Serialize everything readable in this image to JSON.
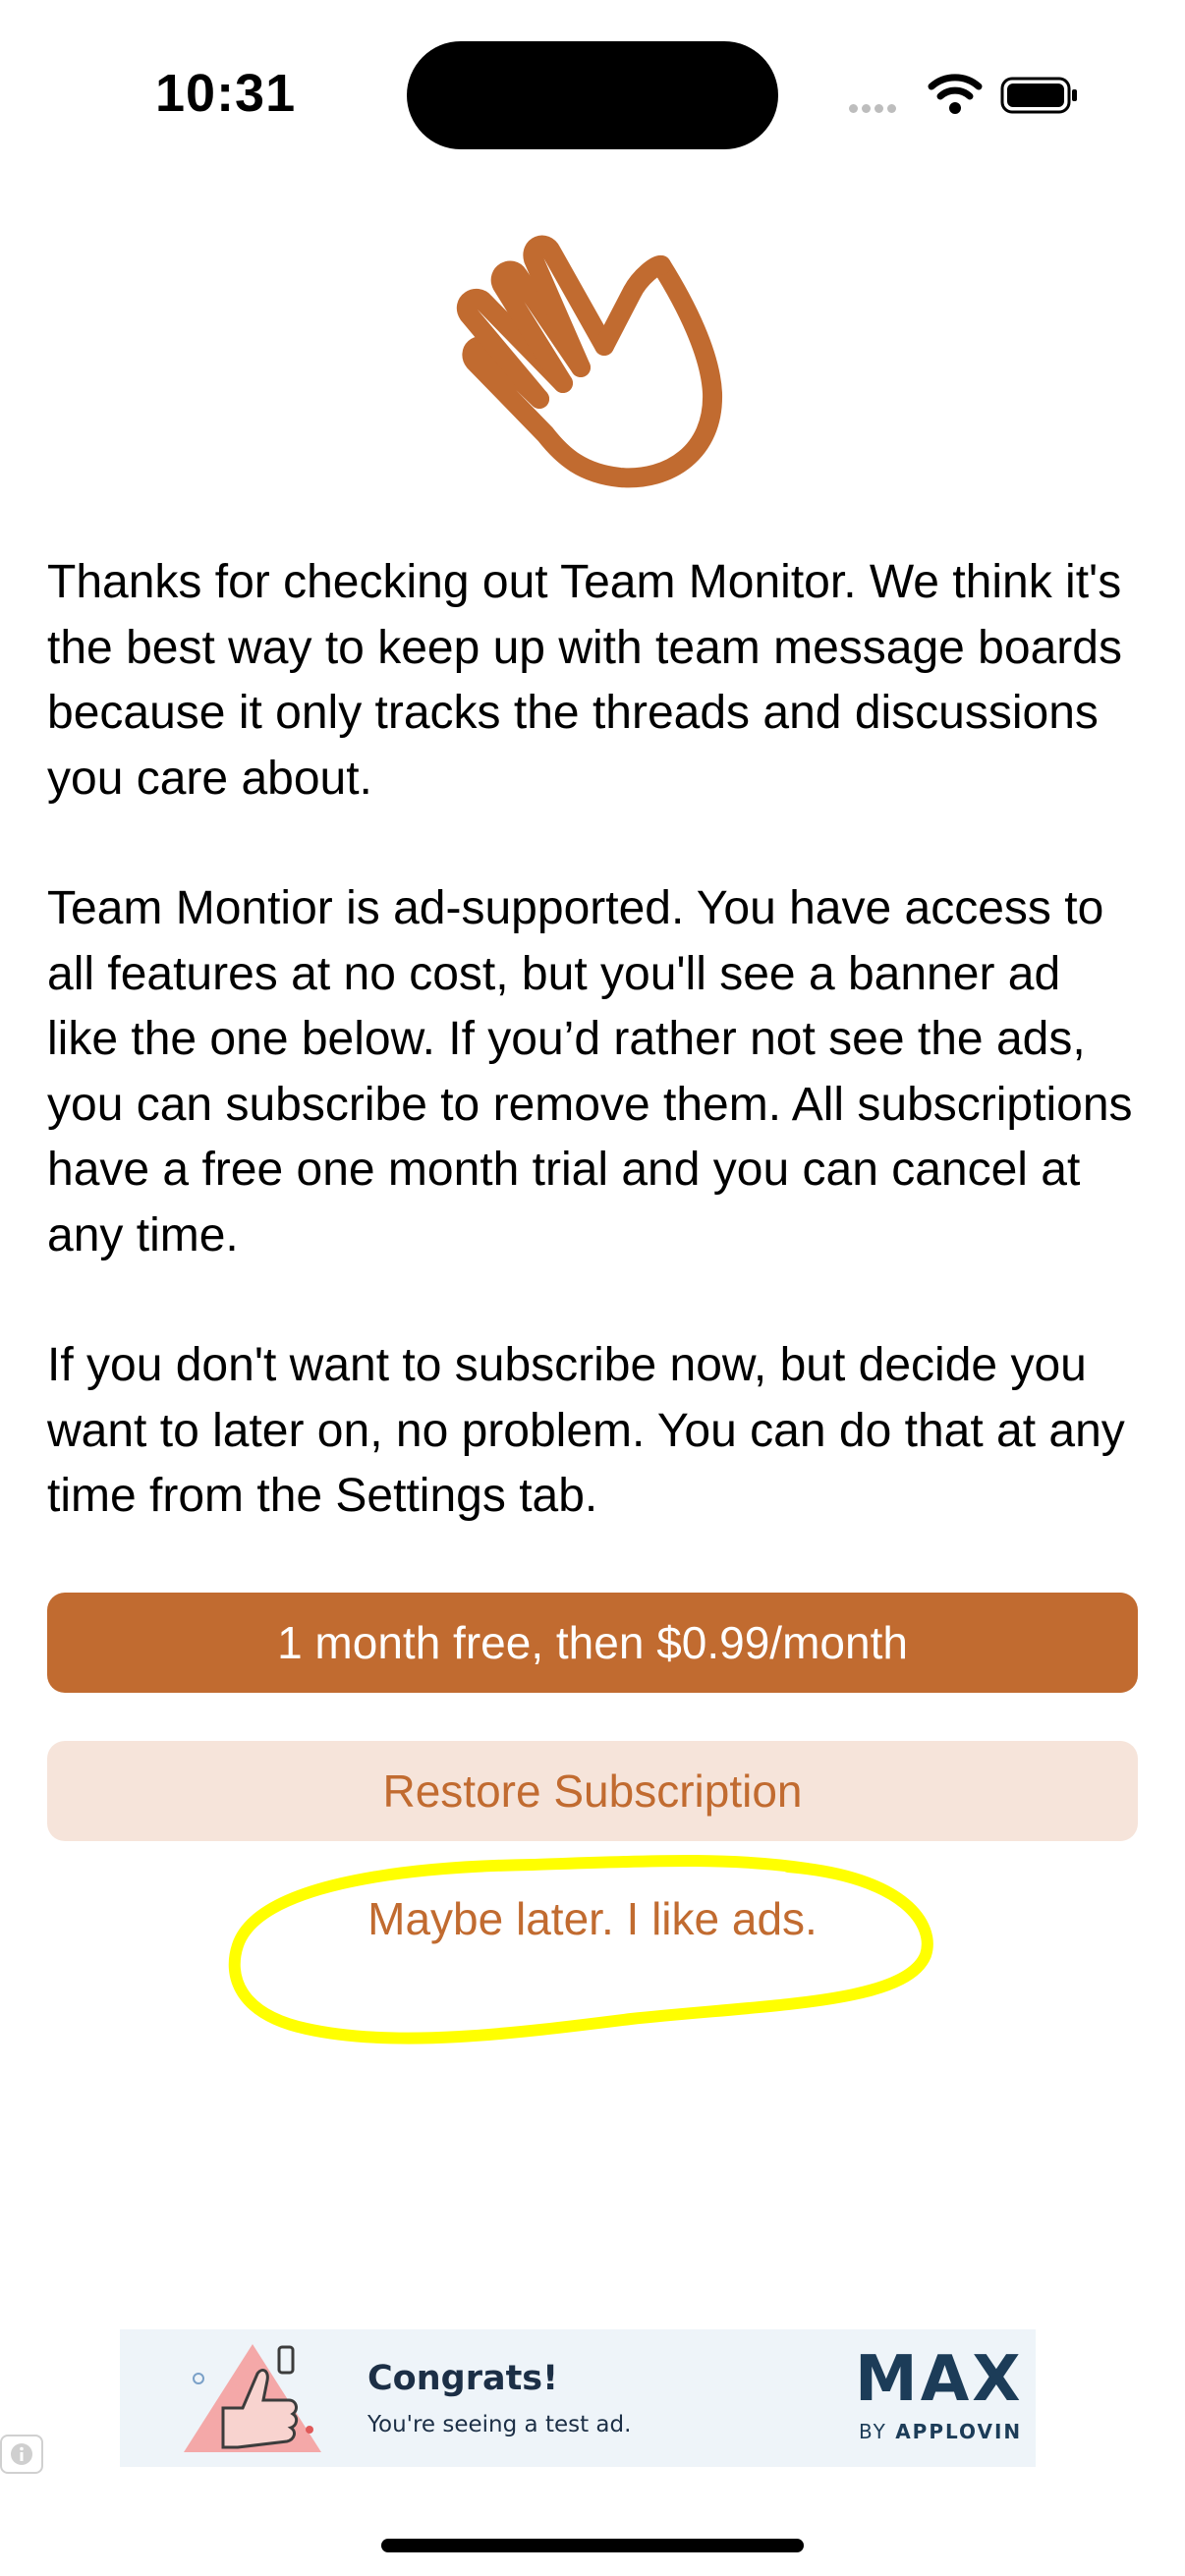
{
  "status_bar": {
    "time": "10:31",
    "icons": [
      "signal-icon",
      "wifi-icon",
      "battery-icon"
    ]
  },
  "hero": {
    "icon": "waving-hand-icon",
    "color": "#c16b30"
  },
  "intro": {
    "paragraphs": [
      "Thanks for checking out Team Monitor. We think it's the best way to keep up with team message boards because it only tracks the threads and discussions you care about.",
      "Team Montior is ad-supported. You have access to all features at no cost, but you'll see a banner ad like the one below. If you’d rather not see the ads, you can subscribe to remove them. All subscriptions have a free one month trial and you can cancel at any time.",
      "If you don't want to subscribe now, but decide you want to later on, no problem. You can do that at any time from the Settings tab."
    ]
  },
  "buttons": {
    "subscribe": "1 month free, then $0.99/month",
    "restore": "Restore Subscription",
    "later": "Maybe later. I like ads."
  },
  "ad": {
    "title": "Congrats!",
    "subtitle": "You're seeing a test ad.",
    "brand": "MAX",
    "by_prefix": "BY ",
    "by_name": "APPLOVIN"
  },
  "colors": {
    "accent": "#c16b30",
    "accent_light": "#f6e4da",
    "highlight": "#ffff00",
    "ad_background": "#eef4f9"
  }
}
